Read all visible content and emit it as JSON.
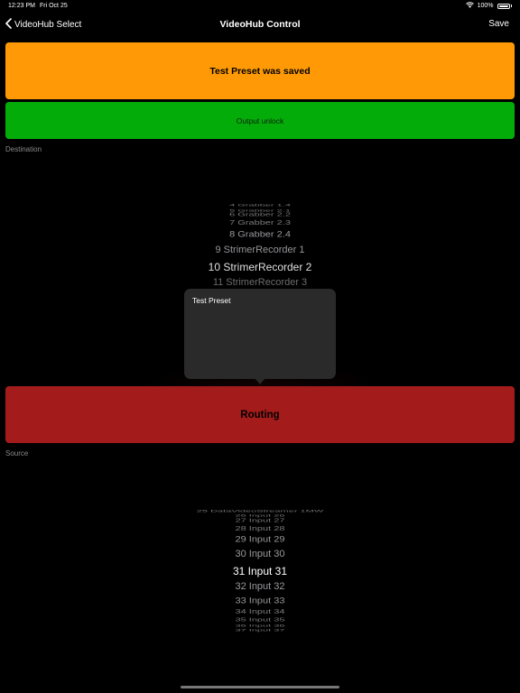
{
  "status_bar": {
    "time": "12:23 PM",
    "date": "Fri Oct 25",
    "battery": "100%"
  },
  "nav": {
    "back_label": "VideoHub Select",
    "title": "VideoHub Control",
    "save_label": "Save"
  },
  "banner": {
    "saved_text": "Test Preset was saved",
    "unlock_label": "Output unlock"
  },
  "destination": {
    "label": "Destination",
    "items": [
      "4 Grabber 1.4",
      "5 Grabber 2.1",
      "6 Grabber 2.2",
      "7 Grabber 2.3",
      "8 Grabber 2.4",
      "9 StrimerRecorder 1",
      "10 StrimerRecorder 2",
      "11 StrimerRecorder 3"
    ],
    "selected": "10 StrimerRecorder 2"
  },
  "popover": {
    "text": "Test Preset"
  },
  "routing": {
    "label": "Routing"
  },
  "source": {
    "label": "Source",
    "items": [
      "25 DataVideoStreamer 1MW",
      "26 Input 26",
      "27 Input 27",
      "28 Input 28",
      "29 Input 29",
      "30 Input 30",
      "31 Input 31",
      "32 Input 32",
      "33 Input 33",
      "34 Input 34",
      "35 Input 35",
      "36 Input 36",
      "37 Input 37"
    ],
    "selected": "31 Input 31"
  },
  "colors": {
    "saved_banner": "#ff9a06",
    "unlock_banner": "#04ac0a",
    "routing_button": "#a31b1b",
    "secondary_label": "#8a8a8e"
  },
  "icons": [
    "back-chevron-icon",
    "wifi-icon",
    "battery-icon"
  ]
}
